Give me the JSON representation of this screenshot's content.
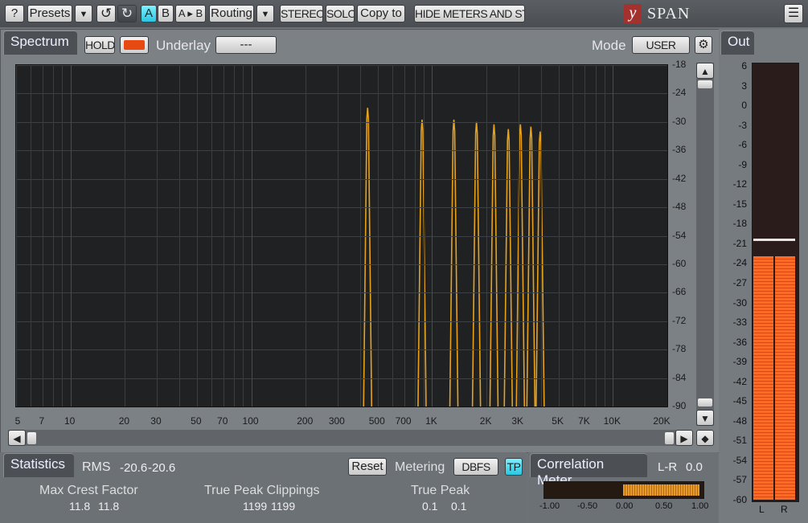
{
  "toolbar": {
    "help": "?",
    "presets": "Presets",
    "ab_a": "A",
    "ab_b": "B",
    "ab_copy": "A ▸ B",
    "routing": "Routing",
    "stereo": "STEREO",
    "solo": "SOLO",
    "copy_to": "Copy to",
    "hide_meters": "HIDE METERS AND STATS",
    "logo_letter": "y",
    "app_name": "SPAN",
    "menu_icon": "hamburger-icon"
  },
  "spectrum": {
    "tab": "Spectrum",
    "hold": "HOLD",
    "underlay_label": "Underlay",
    "underlay_value": "---",
    "mode_label": "Mode",
    "mode_value": "USER",
    "y_ticks": [
      "-18",
      "-24",
      "-30",
      "-36",
      "-42",
      "-48",
      "-54",
      "-60",
      "-66",
      "-72",
      "-78",
      "-84",
      "-90"
    ],
    "x_ticks": [
      "5",
      "7",
      "10",
      "20",
      "30",
      "50",
      "70",
      "100",
      "200",
      "300",
      "500",
      "700",
      "1K",
      "2K",
      "3K",
      "5K",
      "7K",
      "10K",
      "20K"
    ],
    "peaks": [
      {
        "freq_hz": 440,
        "level_db": -27
      },
      {
        "freq_hz": 880,
        "level_db": -29.5
      },
      {
        "freq_hz": 1320,
        "level_db": -29.5
      },
      {
        "freq_hz": 1760,
        "level_db": -30
      },
      {
        "freq_hz": 2200,
        "level_db": -30.5
      },
      {
        "freq_hz": 2640,
        "level_db": -31.5
      },
      {
        "freq_hz": 3080,
        "level_db": -30.5
      },
      {
        "freq_hz": 3520,
        "level_db": -31
      },
      {
        "freq_hz": 3960,
        "level_db": -32
      }
    ]
  },
  "output": {
    "tab": "Out",
    "scale": [
      "6",
      "3",
      "0",
      "-3",
      "-6",
      "-9",
      "-12",
      "-15",
      "-18",
      "-21",
      "-24",
      "-27",
      "-30",
      "-33",
      "-36",
      "-39",
      "-42",
      "-45",
      "-48",
      "-51",
      "-54",
      "-57",
      "-60"
    ],
    "level_db": -23,
    "peak_hold_db": -20.5,
    "channels": [
      "L",
      "R"
    ]
  },
  "statistics": {
    "tab": "Statistics",
    "rms_label": "RMS",
    "rms_l": "-20.6",
    "rms_r": "-20.6",
    "reset": "Reset",
    "metering_label": "Metering",
    "metering_value": "DBFS",
    "tp": "TP",
    "crest_label": "Max Crest Factor",
    "crest_l": "11.8",
    "crest_r": "11.8",
    "clip_label": "True Peak Clippings",
    "clip_l": "1199",
    "clip_r": "1199",
    "tp_label": "True Peak",
    "tp_l": "0.1",
    "tp_r": "0.1"
  },
  "correlation": {
    "tab": "Correlation Meter",
    "lr_label": "L-R",
    "lr_value": "0.0",
    "scale": [
      "-1.00",
      "-0.50",
      "0.00",
      "0.50",
      "1.00"
    ],
    "value": 1.0
  }
}
